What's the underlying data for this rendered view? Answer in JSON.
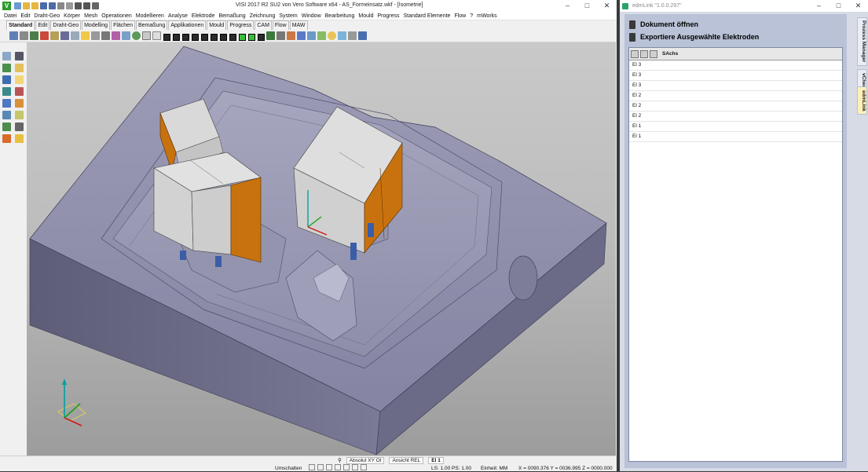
{
  "visi": {
    "title": "VISI 2017 R2 SU2 von Vero Software x64 - AS_Formeinsatz.wkf - [Isometrie]",
    "menu": [
      "Datei",
      "Edit",
      "Draht-Geo",
      "Körper",
      "Mesh",
      "Operationen",
      "Modellieren",
      "Analyse",
      "Elektrode",
      "Bemaßung",
      "Zeichnung",
      "System",
      "Window",
      "Bearbeitung",
      "Mould",
      "Progress",
      "Standard Elemente",
      "Flow",
      "?",
      "mWorks"
    ],
    "tabs": [
      "Standard",
      "Edit",
      "Draht-Geo",
      "Modelling",
      "Flächen",
      "Bemaßung",
      "Applikationen",
      "Mould",
      "Progress",
      "CAM",
      "Flow",
      "MAW"
    ],
    "active_tab": "Standard",
    "status": {
      "coord_mode": "Absolut XY Ot",
      "view_mode": "Ansicht REL",
      "layer": "El 1",
      "switch_label": "Umschalten",
      "ls_ps": "LS: 1.00 PS: 1.00",
      "unit": "Einheit: MM",
      "coords": "X = 0090.376 Y = 0036.995 Z = 0000.000"
    }
  },
  "edm": {
    "title": "edmLink \"1.0.0.297\"",
    "actions": [
      "Dokument öffnen",
      "Exportiere Ausgewählte Elektroden"
    ],
    "column": "SAchs",
    "rows": [
      "El 3",
      "El 3",
      "El 3",
      "El 2",
      "El 2",
      "El 2",
      "El 1",
      "El 1"
    ],
    "side_tabs": [
      "Prozess Manager",
      "vCheck",
      "edmLink"
    ],
    "active_side_tab": "edmLink"
  },
  "colors": {
    "model": "#8b8ba6",
    "electrode_copper": "#c8720f",
    "electrode_body": "#dcdcdc",
    "viewport_bg": "#c6c6c6"
  }
}
